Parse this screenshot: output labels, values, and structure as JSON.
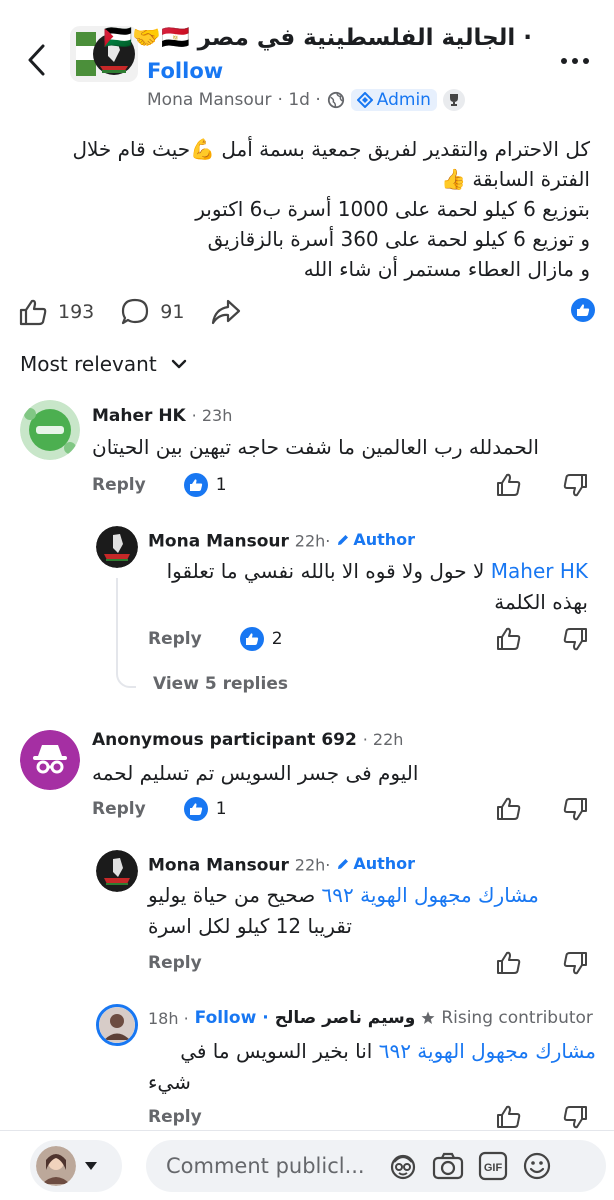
{
  "header": {
    "group_title": "· الجالية الفلسطينية في مصر 🇵🇸🤝🇪🇬",
    "follow_label": "Follow",
    "poster_name": "Mona Mansour",
    "post_age": "· 1d ·",
    "admin_label": "Admin"
  },
  "post": {
    "lines": [
      "كل الاحترام والتقدير لفريق جمعية بسمة أمل 💪حيث قام خلال",
      "الفترة السابقة 👍",
      "بتوزيع 6 كيلو لحمة على 1000 أسرة ب6 اكتوبر",
      "و توزيع 6 كيلو لحمة على 360 أسرة بالزقازيق",
      "و مازال العطاء مستمر أن شاء الله"
    ],
    "like_count": "193",
    "comment_count": "91"
  },
  "sort_label": "Most relevant",
  "comments": [
    {
      "name": "Maher HK",
      "time": "· 23h",
      "body": "الحمدلله رب العالمين ما شفت حاجه تيهين بين الحيتان",
      "reply_label": "Reply",
      "likes": "1"
    },
    {
      "name": "Mona Mansour",
      "time": "22h·",
      "author_label": "Author",
      "mention": "Maher HK",
      "body_line1": "لا حول ولا قوه الا بالله نفسي ما تعلقوا",
      "body_line2": "بهذه الكلمة",
      "reply_label": "Reply",
      "likes": "2",
      "view_replies": "View 5 replies"
    },
    {
      "name": "Anonymous participant 692",
      "time": "· 22h",
      "body": "اليوم فى جسر السويس تم تسليم لحمه",
      "reply_label": "Reply",
      "likes": "1"
    },
    {
      "name": "Mona Mansour",
      "time": "22h·",
      "author_label": "Author",
      "mention": "مشارك مجهول الهوية ٦٩٢",
      "body_line1": "صحيح من حياة يوليو",
      "body_line2": "تقريبا 12 كيلو لكل اسرة",
      "reply_label": "Reply"
    },
    {
      "name": "وسيم ناصر صالح",
      "time": "18h ·",
      "follow_label": "Follow ·",
      "badge": "Rising contributor",
      "mention": "مشارك مجهول الهوية ٦٩٢",
      "body_line1": "انا بخير السويس  ما في",
      "body_line2": "شيء",
      "reply_label": "Reply"
    }
  ],
  "composer": {
    "placeholder": "Comment publicl..."
  }
}
